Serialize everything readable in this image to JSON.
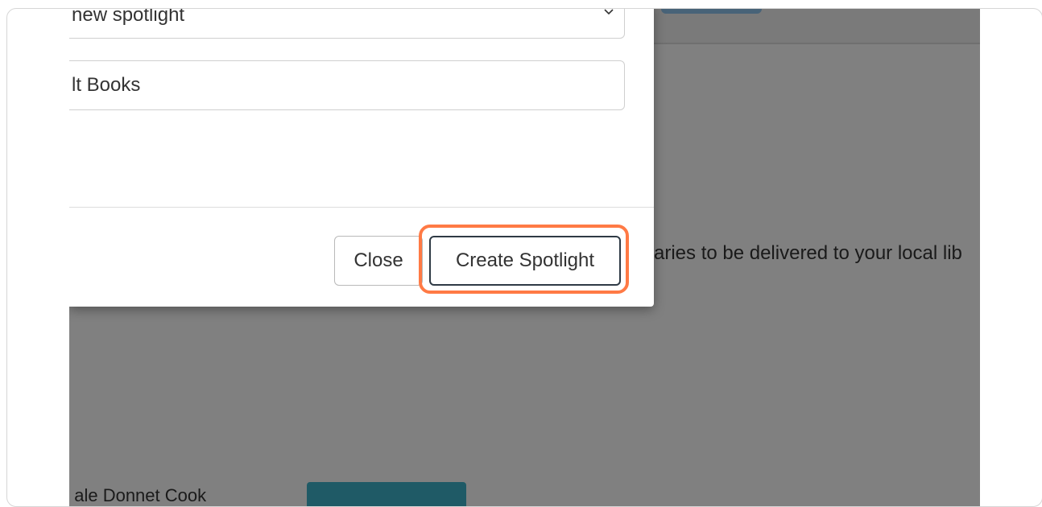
{
  "modal": {
    "select_value": "new spotlight",
    "title_value": "lt Books",
    "close_label": "Close",
    "create_label": "Create Spotlight"
  },
  "page": {
    "text_behind": "aries to be delivered to your local lib",
    "bottom_text": "t ale Donnet Cook"
  },
  "colors": {
    "highlight": "#ff7a45",
    "overlay": "#808080",
    "bottom_button": "#1f5a66"
  },
  "icons": {
    "select_chevron": "chevron-down-icon"
  }
}
